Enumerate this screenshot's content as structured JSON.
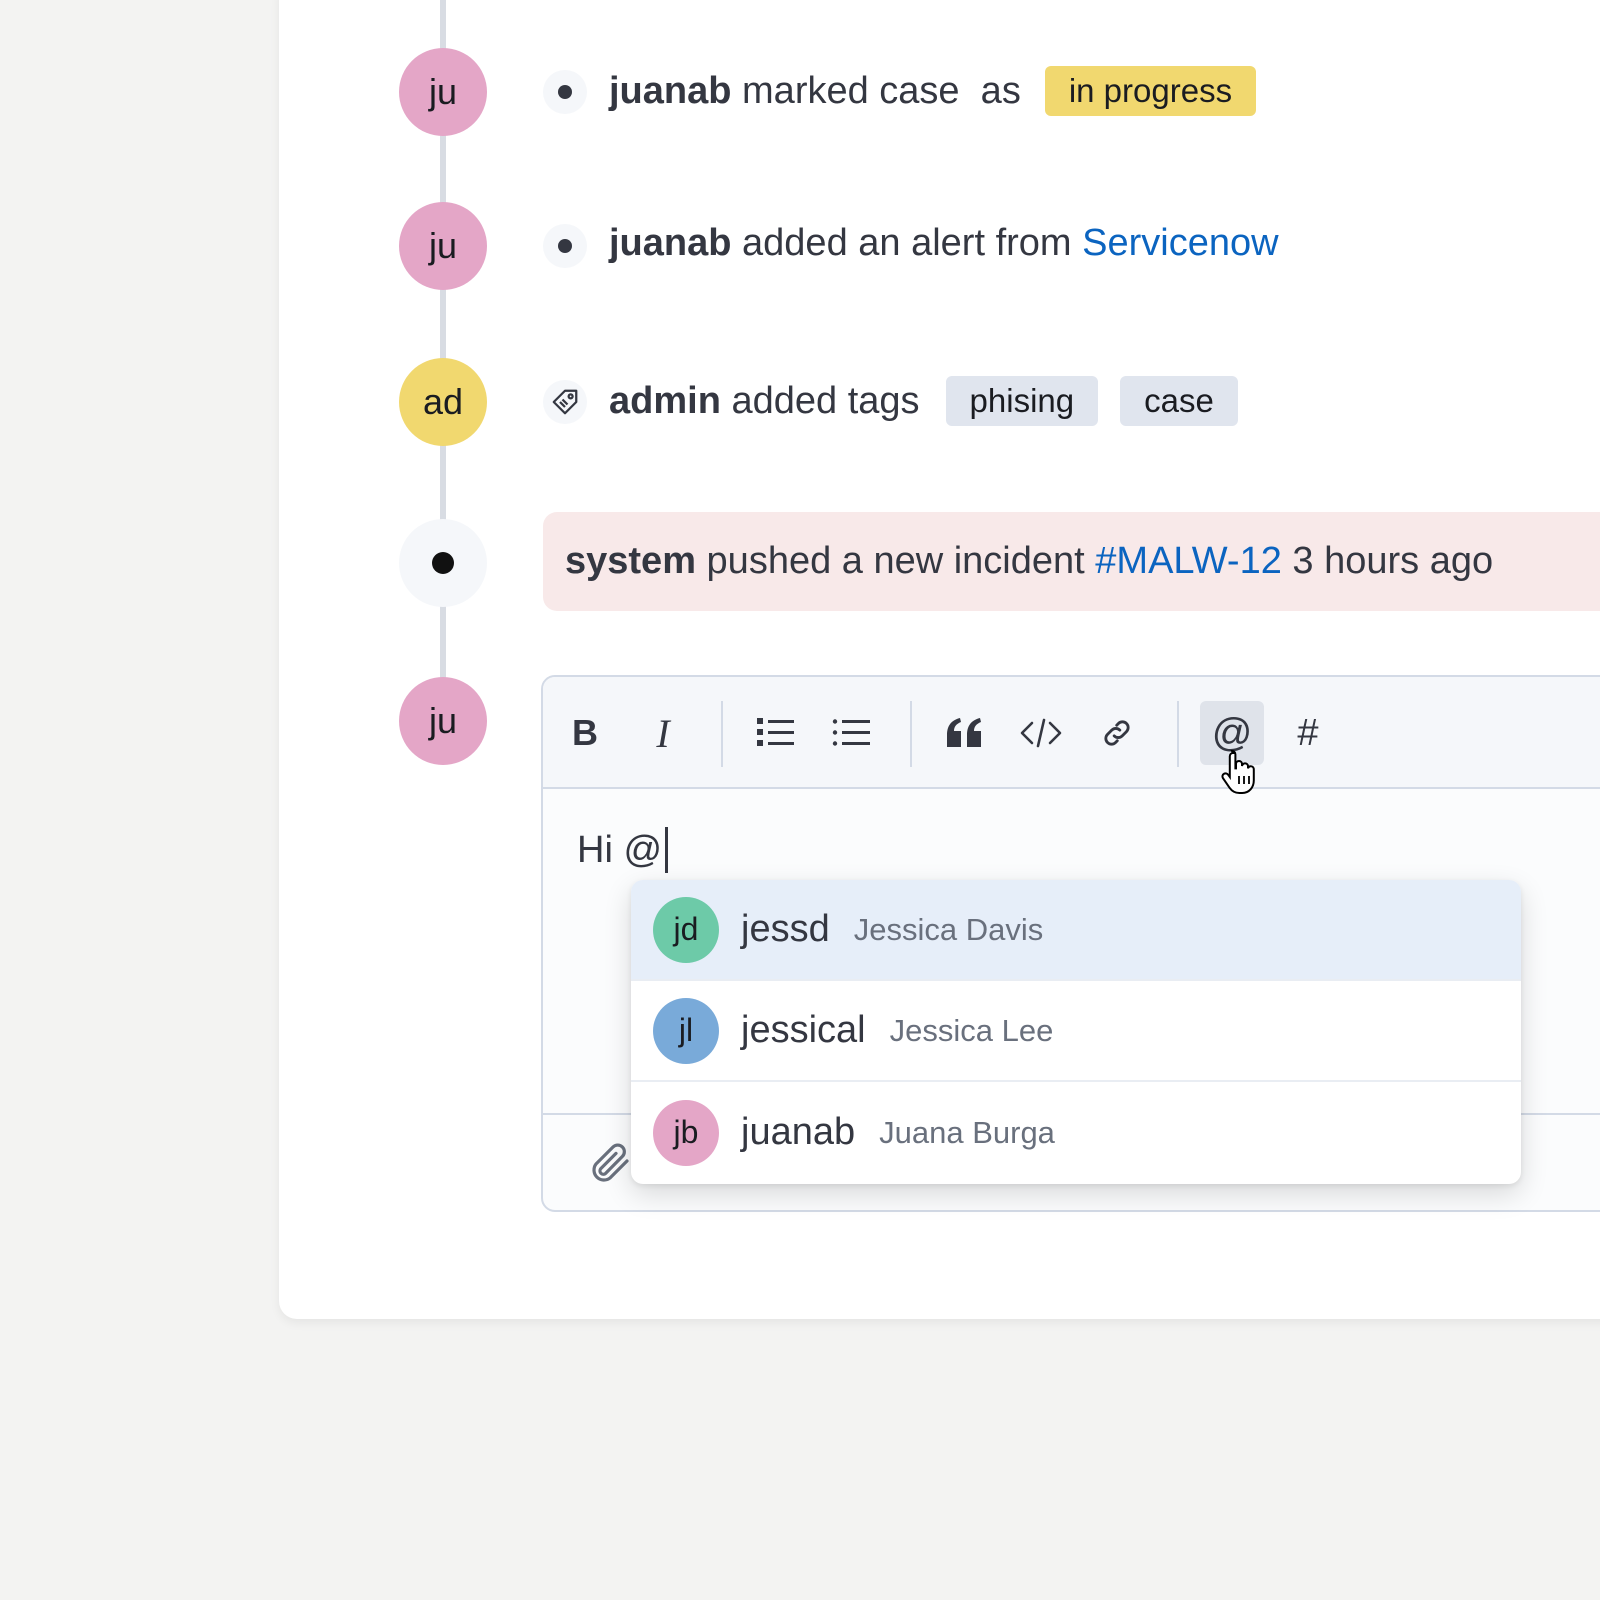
{
  "timeline": {
    "events": [
      {
        "avatar": "ju",
        "user": "juanab",
        "text": "marked case  as",
        "badge": "in progress"
      },
      {
        "avatar": "ju",
        "user": "juanab",
        "text": "added an alert from",
        "link": "Servicenow"
      },
      {
        "avatar": "ad",
        "user": "admin",
        "text": "added tags",
        "tags": [
          "phising",
          "case"
        ]
      }
    ],
    "system_event": {
      "user": "system",
      "text": "pushed a new incident",
      "link": "#MALW-12",
      "time": "3 hours ago"
    },
    "composer_avatar": "ju"
  },
  "editor": {
    "toolbar": {
      "bold": "B",
      "italic": "I",
      "mention": "@",
      "hashtag": "#"
    },
    "content": "Hi @"
  },
  "mention_menu": {
    "items": [
      {
        "initials": "jd",
        "username": "jessd",
        "name": "Jessica Davis",
        "color": "#6dcaa8",
        "selected": true
      },
      {
        "initials": "jl",
        "username": "jessical",
        "name": "Jessica Lee",
        "color": "#79aad9",
        "selected": false
      },
      {
        "initials": "jb",
        "username": "juanab",
        "name": "Juana Burga",
        "color": "#e4a6c7",
        "selected": false
      }
    ]
  },
  "colors": {
    "avatar_pink": "#e4a6c7",
    "avatar_yellow": "#f1d86f",
    "link": "#0b64c0",
    "badge_in_progress": "#f1d86f",
    "tag_bg": "#e0e5ee",
    "system_bg": "#f8e9e9",
    "selected_row": "#e6eef9"
  }
}
